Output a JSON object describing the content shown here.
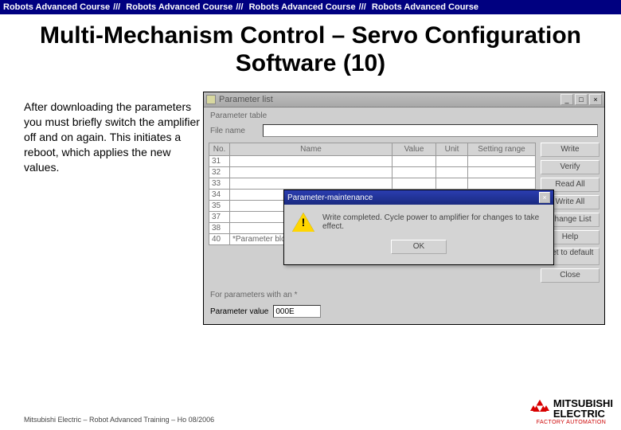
{
  "banner": {
    "item": "Robots Advanced Course",
    "sep": "///"
  },
  "title": "Multi-Mechanism Control – Servo Configuration Software (10)",
  "left_text": "After downloading the parameters you must briefly switch the amplifier off and on again. This initiates a reboot, which applies the new values.",
  "footer": "Mitsubishi Electric – Robot Advanced Training – Ho 08/2006",
  "logo": {
    "brand1": "MITSUBISHI",
    "brand2": "ELECTRIC",
    "tag": "FACTORY AUTOMATION"
  },
  "app": {
    "window_title": "Parameter list",
    "section": "Parameter table",
    "file_label": "File name",
    "columns": [
      "No.",
      "Name",
      "Value",
      "Unit",
      "Setting range"
    ],
    "rows": [
      "31",
      "32",
      "33",
      "34",
      "35",
      "37",
      "38",
      "40"
    ],
    "row40_text": "*Parameter block",
    "buttons": {
      "write": "Write",
      "verify": "Verify",
      "read_all": "Read All",
      "write_all": "Write All",
      "change_list": "Change List",
      "help": "Help",
      "set_default": "Set to default",
      "close": "Close"
    },
    "hint": "For parameters with an *",
    "pv_label": "Parameter value",
    "pv_value": "000E"
  },
  "msg": {
    "title": "Parameter-maintenance",
    "text": "Write completed. Cycle power to amplifier for changes to take effect.",
    "ok": "OK"
  }
}
